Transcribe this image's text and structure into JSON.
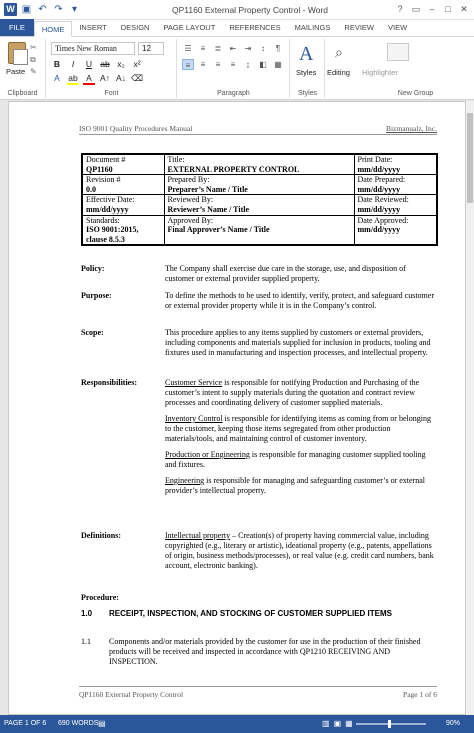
{
  "window": {
    "title": "QP1160 External Property Control - Word",
    "app_icon": "W"
  },
  "tabs": [
    "FILE",
    "HOME",
    "INSERT",
    "DESIGN",
    "PAGE LAYOUT",
    "REFERENCES",
    "MAILINGS",
    "REVIEW",
    "VIEW"
  ],
  "active_tab": "HOME",
  "ribbon": {
    "paste_label": "Paste",
    "clipboard_label": "Clipboard",
    "font_name": "Times New Roman",
    "font_size": "12",
    "font_label": "Font",
    "paragraph_label": "Paragraph",
    "styles_label": "Styles",
    "styles_group_label": "Styles",
    "editing_label": "Editing",
    "highlighter_label": "Highlighter",
    "new_group_label": "New Group"
  },
  "header": {
    "left": "ISO 9001 Quality Procedures Manual",
    "right": "Bizmanualz, Inc."
  },
  "meta": {
    "doc_label": "Document #",
    "doc_value": "QP1160",
    "title_label": "Title:",
    "title_value": "EXTERNAL PROPERTY CONTROL",
    "print_label": "Print Date:",
    "print_value": "mm/dd/yyyy",
    "rev_label": "Revision #",
    "rev_value": "0.0",
    "prep_label": "Prepared By:",
    "prep_value": "Preparer’s Name / Title",
    "dprep_label": "Date Prepared:",
    "dprep_value": "mm/dd/yyyy",
    "eff_label": "Effective Date:",
    "eff_value": "mm/dd/yyyy",
    "rev_by_label": "Reviewed By:",
    "rev_by_value": "Reviewer’s Name / Title",
    "drev_label": "Date Reviewed:",
    "drev_value": "mm/dd/yyyy",
    "std_label": "Standards:",
    "std_value": "ISO 9001:2015, clause 8.5.3",
    "appr_label": "Approved By:",
    "appr_value": "Final Approver’s Name / Title",
    "dappr_label": "Date Approved:",
    "dappr_value": "mm/dd/yyyy"
  },
  "sections": {
    "policy_label": "Policy:",
    "policy_text": "The Company shall exercise due care in the storage, use, and disposition of customer or external provider supplied property.",
    "purpose_label": "Purpose:",
    "purpose_text": "To define the methods to be used to identify, verify, protect, and safeguard customer or external provider property while it is in the Company’s control.",
    "scope_label": "Scope:",
    "scope_text": "This procedure applies to any items supplied by customers or external providers, including components and materials supplied for inclusion in products, tooling and fixtures used in manufacturing and inspection processes, and intellectual property.",
    "resp_label": "Responsibilities:",
    "resp1_role": "Customer Service",
    "resp1_text": " is responsible for notifying Production and Purchasing of the customer’s intent to supply materials during the quotation and contract review processes and coordinating delivery of customer supplied materials.",
    "resp2_role": "Inventory Control",
    "resp2_text": " is responsible for identifying items as coming from or belonging to the customer, keeping those items segregated from other production materials/tools, and maintaining control of customer inventory.",
    "resp3_role": "Production or Engineering",
    "resp3_text": " is responsible for managing customer supplied tooling and fixtures.",
    "resp4_role": "Engineering",
    "resp4_text": " is responsible for managing and safeguarding customer’s or external provider’s intellectual property.",
    "def_label": "Definitions:",
    "def_term": "Intellectual property",
    "def_text": " – Creation(s) of property having commercial value, including copyrighted (e.g., literary or artistic), ideational property (e.g., patents, appellations of origin, business methods/processes), or real value (e.g. credit card numbers, bank account, electronic banking).",
    "proc_label": "Procedure:",
    "s1_num": "1.0",
    "s1_title": "RECEIPT, INSPECTION, AND STOCKING OF CUSTOMER SUPPLIED ITEMS",
    "s11_num": "1.1",
    "s11_text": "Components and/or materials provided by the customer for use in the production of their finished products will be received and inspected in accordance with QP1210 RECEIVING AND INSPECTION."
  },
  "footer": {
    "left": "QP1160 External Property Control",
    "right": "Page 1 of 6"
  },
  "status": {
    "page": "PAGE 1 OF 6",
    "words": "690 WORDS",
    "zoom": "90%",
    "zoom_fraction": 0.45
  }
}
